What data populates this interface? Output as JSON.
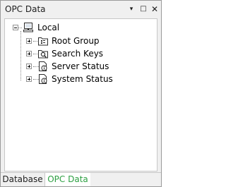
{
  "panel": {
    "title": "OPC Data",
    "buttons": {
      "pin": "▾",
      "maximize": "□",
      "close": "✕"
    }
  },
  "tree": {
    "root": {
      "label": "Local",
      "icon": "computer-icon",
      "expanded": true
    },
    "children": [
      {
        "label": "Root Group",
        "icon": "group-folder-icon",
        "expanded": false
      },
      {
        "label": "Search Keys",
        "icon": "search-folder-icon",
        "expanded": false
      },
      {
        "label": "Server Status",
        "icon": "info-document-icon",
        "expanded": false
      },
      {
        "label": "System Status",
        "icon": "info-document-icon",
        "expanded": false
      }
    ]
  },
  "tabs": [
    {
      "label": "Database",
      "active": false
    },
    {
      "label": "OPC Data",
      "active": true,
      "color": "#2ea043"
    }
  ]
}
